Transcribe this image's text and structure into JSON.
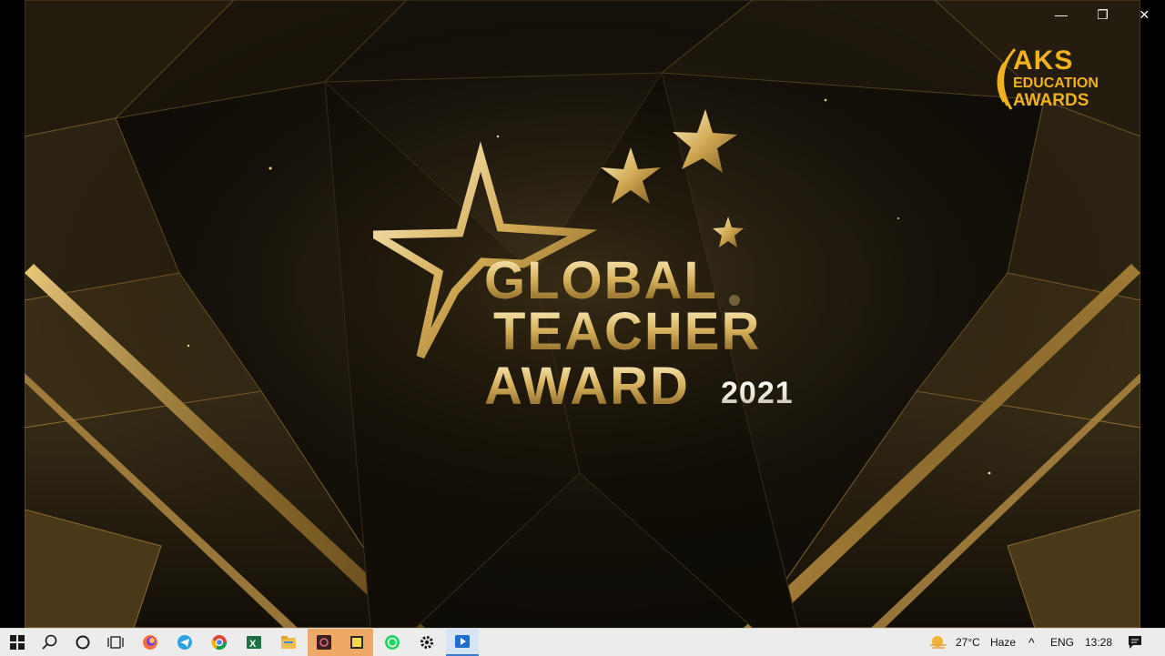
{
  "window_controls": {
    "minimize": "—",
    "restore": "❐",
    "close": "✕"
  },
  "video": {
    "corner_logo": {
      "line1": "AKS",
      "line2": "EDUCATION",
      "line3": "AWARDS",
      "color": "#f2b21f"
    },
    "main_logo": {
      "line1": "GLOBAL",
      "line2": "TEACHER",
      "line3": "AWARD",
      "year": "2021"
    }
  },
  "taskbar": {
    "apps": [
      "start-icon",
      "search-icon",
      "cortana-icon",
      "task-view-icon",
      "firefox-icon",
      "telegram-icon",
      "chrome-icon",
      "excel-icon",
      "file-explorer-icon",
      "app-icon",
      "sticky-notes-icon",
      "whatsapp-icon",
      "settings-icon",
      "media-player-icon"
    ],
    "weather": {
      "temp": "27°C",
      "condition": "Haze"
    },
    "tray": {
      "chevron": "^",
      "language": "ENG",
      "time": "13:28"
    }
  }
}
